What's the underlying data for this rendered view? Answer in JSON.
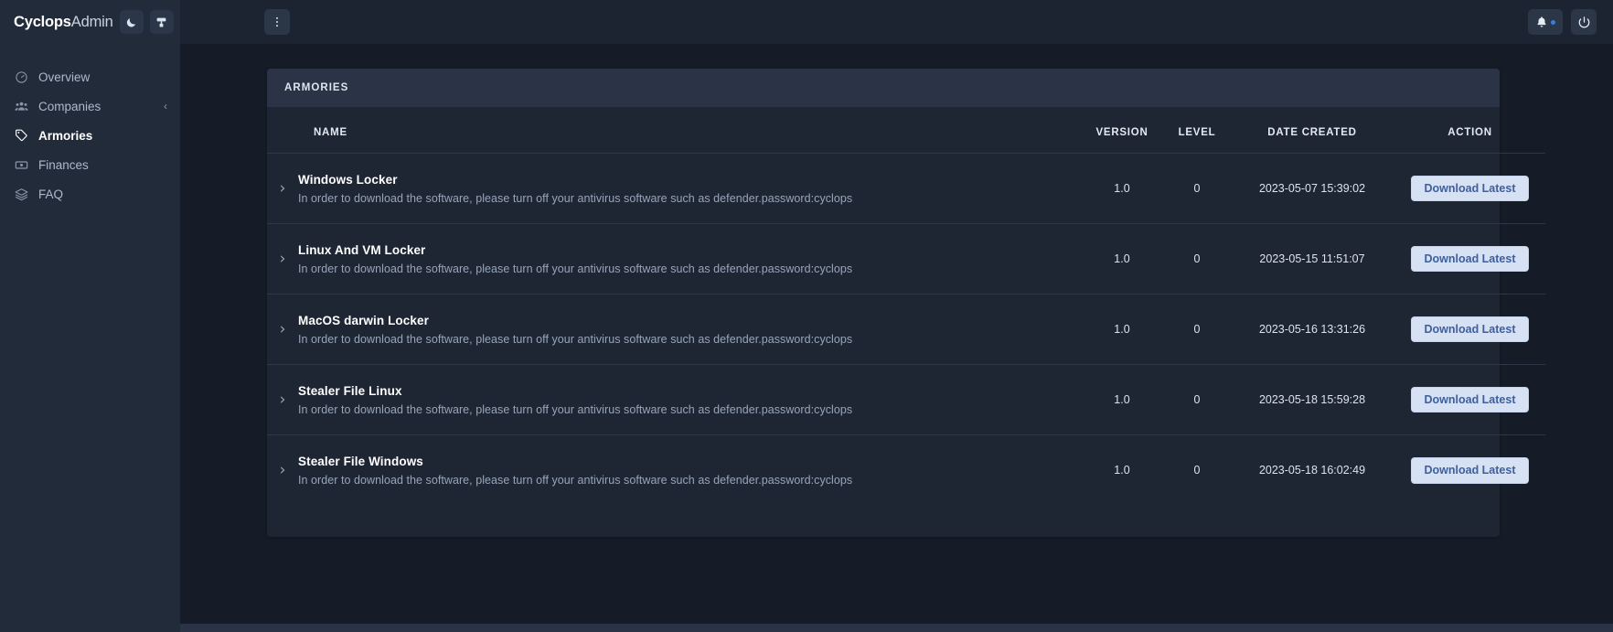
{
  "brand": {
    "name_bold": "Cyclops",
    "name_rest": "Admin",
    "theme_toggle_icon": "moon-icon",
    "palette_icon": "paint-roller-icon"
  },
  "topbar": {
    "menu_icon": "kebab-menu-icon",
    "notifications_icon": "bell-icon",
    "power_icon": "power-icon"
  },
  "sidebar": {
    "items": [
      {
        "label": "Overview",
        "icon": "gauge-icon",
        "active": false,
        "chevron": ""
      },
      {
        "label": "Companies",
        "icon": "people-icon",
        "active": false,
        "chevron": "‹"
      },
      {
        "label": "Armories",
        "icon": "tag-icon",
        "active": true,
        "chevron": ""
      },
      {
        "label": "Finances",
        "icon": "banknote-icon",
        "active": false,
        "chevron": ""
      },
      {
        "label": "FAQ",
        "icon": "layers-icon",
        "active": false,
        "chevron": ""
      }
    ]
  },
  "card": {
    "title": "ARMORIES",
    "columns": [
      "NAME",
      "VERSION",
      "LEVEL",
      "DATE CREATED",
      "ACTION"
    ],
    "expand_icon": "chevron-right-icon",
    "action_label": "Download Latest",
    "rows": [
      {
        "name": "Windows Locker",
        "description": "In order to download the software, please turn off your antivirus software such as defender.password:cyclops",
        "version": "1.0",
        "level": "0",
        "date_created": "2023-05-07 15:39:02",
        "action": "Download Latest"
      },
      {
        "name": "Linux And VM Locker",
        "description": "In order to download the software, please turn off your antivirus software such as defender.password:cyclops",
        "version": "1.0",
        "level": "0",
        "date_created": "2023-05-15 11:51:07",
        "action": "Download Latest"
      },
      {
        "name": "MacOS darwin Locker",
        "description": "In order to download the software, please turn off your antivirus software such as defender.password:cyclops",
        "version": "1.0",
        "level": "0",
        "date_created": "2023-05-16 13:31:26",
        "action": "Download Latest"
      },
      {
        "name": "Stealer File Linux",
        "description": "In order to download the software, please turn off your antivirus software such as defender.password:cyclops",
        "version": "1.0",
        "level": "0",
        "date_created": "2023-05-18 15:59:28",
        "action": "Download Latest"
      },
      {
        "name": "Stealer File Windows",
        "description": "In order to download the software, please turn off your antivirus software such as defender.password:cyclops",
        "version": "1.0",
        "level": "0",
        "date_created": "2023-05-18 16:02:49",
        "action": "Download Latest"
      }
    ]
  },
  "colors": {
    "sidebar_bg": "#222b3a",
    "topbar_bg": "#1b2430",
    "page_bg": "#151c27",
    "card_bg": "#1e2634",
    "card_header_bg": "#2a3446",
    "accent": "#3b7ddd",
    "button_bg": "#d7e1f4",
    "button_text": "#3e5f9e"
  }
}
